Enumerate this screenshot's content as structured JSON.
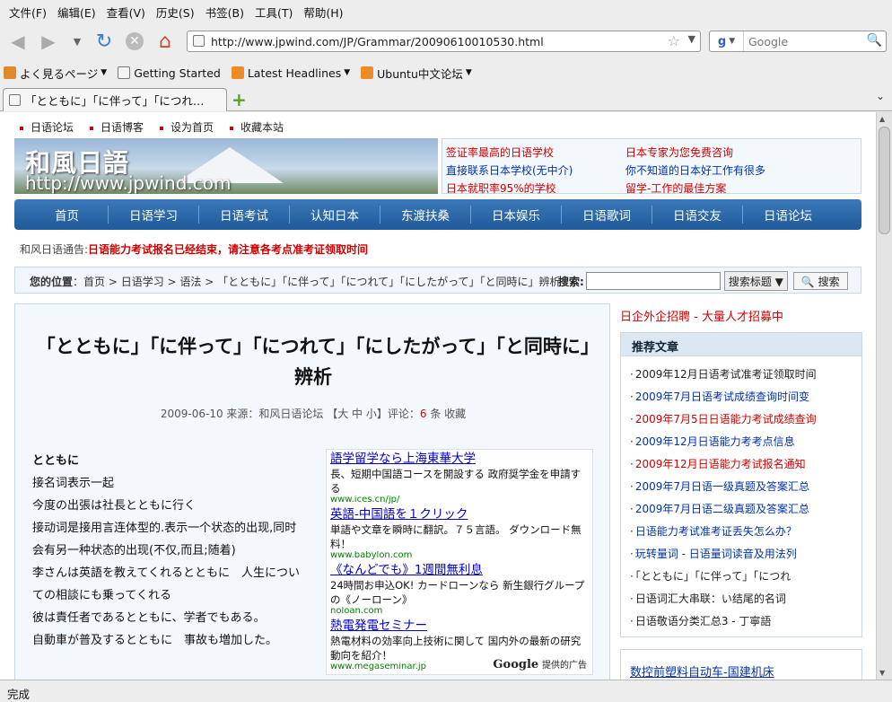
{
  "menu": [
    "文件(F)",
    "编辑(E)",
    "查看(V)",
    "历史(S)",
    "书签(B)",
    "工具(T)",
    "帮助(H)"
  ],
  "url": "http://www.jpwind.com/JP/Grammar/20090610010530.html",
  "search_placeholder": "Google",
  "bookmarks": [
    "よく見るページ",
    "Getting Started",
    "Latest Headlines",
    "Ubuntu中文论坛"
  ],
  "tab_title": "「とともに」「に伴って」「につれ…",
  "status": "完成",
  "site": {
    "toplinks": [
      "日语论坛",
      "日语博客",
      "设为首页",
      "收藏本站"
    ],
    "logo": "和風日語",
    "logo_url": "http://www.jpwind.com",
    "adlinks_left": [
      "签证率最高的日语学校",
      "直接联系日本学校(无中介)",
      "日本就职率95%的学校"
    ],
    "adlinks_right": [
      "日本专家为您免费咨询",
      "你不知道的日本好工作有很多",
      "留学-工作的最佳方案"
    ],
    "nav": [
      "首页",
      "日语学习",
      "日语考试",
      "认知日本",
      "东渡扶桑",
      "日本娱乐",
      "日语歌词",
      "日语交友",
      "日语论坛"
    ],
    "notice_label": "和风日语通告:",
    "notice": "日语能力考试报名已经结束，请注意各考点准考证领取时间",
    "breadcrumb_label": "您的位置",
    "breadcrumb": "：首页 > 日语学习 > 语法 > 「とともに」「に伴って」「につれて」「にしたがって」「と同時に」辨析",
    "search_label": "搜索:",
    "search_select": "搜索标题",
    "search_button": "搜索"
  },
  "article": {
    "title": "「とともに」「に伴って」「につれて」「にしたがって」「と同時に」辨析",
    "meta_pre": "2009-06-10 来源：和风日语论坛 【大 中 小】评论：",
    "comments": "6",
    "meta_post": "条 收藏",
    "body": [
      "とともに",
      "接名词表示一起",
      "今度の出張は社長とともに行く",
      "接动词是接用言连体型的.表示一个状态的出现,同时",
      "会有另一种状态的出现(不仅,而且;随着)",
      "李さんは英語を教えてくれるとともに　人生につい",
      "ての相談にも乗ってくれる",
      "彼は責任者であるとともに、学者でもある。",
      "自動車が普及するとともに　事故も増加した。"
    ]
  },
  "google_ads": [
    {
      "title": "語学留学なら上海東華大学",
      "desc": "長、短期中国語コースを開設する 政府奨学金を申請する",
      "url": "www.ices.cn/jp/"
    },
    {
      "title": "英語-中国語を１クリック",
      "desc": "単語や文章を瞬時に翻訳。７５言語。 ダウンロード無料！",
      "url": "www.babylon.com"
    },
    {
      "title": "《なんどでも》1週間無利息",
      "desc": "24時間お申込OK! カードローンなら 新生銀行グループの《ノーローン》",
      "url": "noloan.com"
    },
    {
      "title": "熱電発電セミナー",
      "desc": "熱電材料の効率向上技術に関して 国内外の最新の研究動向を紹介！",
      "url": "www.megaseminar.jp"
    }
  ],
  "google_foot": "Google",
  "google_foot2": "提供的广告",
  "recruit": "日企外企招聘 - 大量人才招募中",
  "recommend_title": "推荐文章",
  "recommend": [
    {
      "text": "2009年12月日语考试准考证领取时间",
      "color": "dark"
    },
    {
      "text": "2009年7月日语考试成绩查询时间变",
      "color": "blue"
    },
    {
      "text": "2009年7月5日日语能力考试成绩查询",
      "color": "red"
    },
    {
      "text": "2009年12月日语能力考考点信息",
      "color": "blue"
    },
    {
      "text": "2009年12月日语能力考试报名通知",
      "color": "red"
    },
    {
      "text": "2009年7月日语一级真题及答案汇总",
      "color": "blue"
    },
    {
      "text": "2009年7月日语二级真题及答案汇总",
      "color": "blue"
    },
    {
      "text": "日语能力考试准考证丢失怎么办？",
      "color": "blue"
    },
    {
      "text": "玩转量词 - 日语量词读音及用法列",
      "color": "blue"
    },
    {
      "text": "「とともに」「に伴って」「につれ",
      "color": "dark"
    },
    {
      "text": "日语词汇大串联：い结尾的名词",
      "color": "dark"
    },
    {
      "text": "日语敬语分类汇总3 - 丁寧語",
      "color": "dark"
    }
  ],
  "bottom_ad": "数控前塑料自动车-国建机床"
}
